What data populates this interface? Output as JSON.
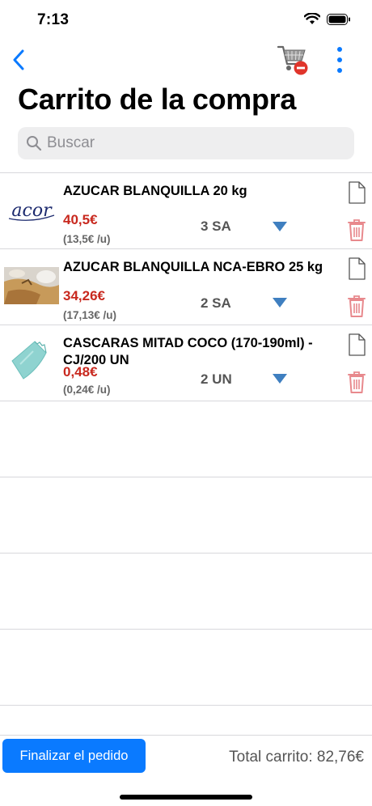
{
  "status_bar": {
    "time": "7:13"
  },
  "nav": {
    "back_icon": "chevron-left-icon",
    "cart_icon": "cart-remove-icon",
    "more_icon": "more-vertical-icon"
  },
  "page": {
    "title": "Carrito de la compra"
  },
  "search": {
    "placeholder": "Buscar",
    "value": ""
  },
  "items": [
    {
      "name": "AZUCAR BLANQUILLA 20 kg",
      "price": "40,5€",
      "unit_price": "(13,5€ /u)",
      "quantity": "3 SA",
      "image": "acor-logo"
    },
    {
      "name": "AZUCAR BLANQUILLA NCA-EBRO 25 kg",
      "price": "34,26€",
      "unit_price": "(17,13€ /u)",
      "quantity": "2 SA",
      "image": "sugar-photo"
    },
    {
      "name": "CASCARAS MITAD COCO (170-190ml) - CJ/200 UN",
      "price": "0,48€",
      "unit_price": "(0,24€ /u)",
      "quantity": "2 UN",
      "image": "coco-scraper"
    }
  ],
  "colors": {
    "accent": "#0a7aff",
    "price": "#c8281e",
    "trash": "#e8898d",
    "arrow": "#3f7fc0"
  },
  "footer": {
    "finish_label": "Finalizar el pedido",
    "total": "Total carrito: 82,76€"
  }
}
